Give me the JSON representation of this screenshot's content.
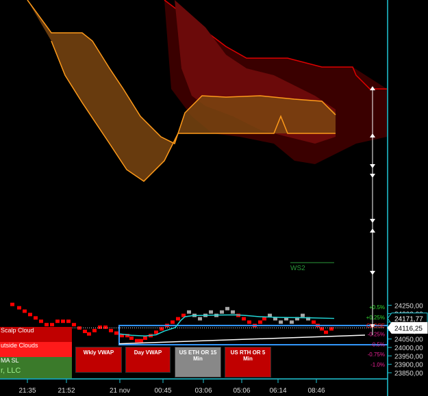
{
  "chart_data": {
    "type": "renko",
    "y_range": [
      23840,
      24290
    ],
    "y_ticks": [
      23850,
      23900,
      23950,
      24000,
      24050,
      24100,
      24150,
      24200,
      24250
    ],
    "y_tick_labels": [
      "23850,00",
      "23900,00",
      "23950,00",
      "24000,00",
      "24050,00",
      "24100,00",
      "24150,00",
      "24200,00",
      "24250,00"
    ],
    "x_labels": [
      "21:35",
      "21:52",
      "21 nov",
      "00:45",
      "03:06",
      "05:06",
      "06:14",
      "08:46"
    ],
    "last_price": "24171,77",
    "crosshair_price": "24116,25",
    "crosshair_value": 24116.25,
    "last_value": 24171.77,
    "pct_levels": [
      {
        "label": "+0.5%",
        "value": 24240,
        "color": "#33dd33"
      },
      {
        "label": "+0.25%",
        "value": 24179,
        "color": "#33dd33"
      },
      {
        "label": "CLOSE",
        "value": 24130,
        "color": "#ff2222"
      },
      {
        "label": "-0.25%",
        "value": 24079,
        "color": "#ee2299"
      },
      {
        "label": "-0.5%",
        "value": 24018,
        "color": "#ee2299"
      },
      {
        "label": "-0.75%",
        "value": 23960,
        "color": "#ee2299"
      },
      {
        "label": "-1.0%",
        "value": 23899,
        "color": "#ee2299"
      }
    ],
    "ws2_label": "WS2",
    "box_levels": [
      24130,
      24016
    ],
    "bricks": [
      {
        "x": 18,
        "c": "r",
        "lo": 24245,
        "hi": 24265
      },
      {
        "x": 28,
        "c": "r",
        "lo": 24225,
        "hi": 24245
      },
      {
        "x": 36,
        "c": "r",
        "lo": 24205,
        "hi": 24225
      },
      {
        "x": 44,
        "c": "r",
        "lo": 24185,
        "hi": 24205
      },
      {
        "x": 52,
        "c": "r",
        "lo": 24165,
        "hi": 24185
      },
      {
        "x": 60,
        "c": "r",
        "lo": 24145,
        "hi": 24165
      },
      {
        "x": 68,
        "c": "r",
        "lo": 24125,
        "hi": 24145
      },
      {
        "x": 76,
        "c": "r",
        "lo": 24125,
        "hi": 24145
      },
      {
        "x": 84,
        "c": "r",
        "lo": 24145,
        "hi": 24165
      },
      {
        "x": 92,
        "c": "r",
        "lo": 24145,
        "hi": 24165
      },
      {
        "x": 100,
        "c": "r",
        "lo": 24145,
        "hi": 24165
      },
      {
        "x": 108,
        "c": "r",
        "lo": 24125,
        "hi": 24145
      },
      {
        "x": 116,
        "c": "r",
        "lo": 24105,
        "hi": 24125
      },
      {
        "x": 124,
        "c": "r",
        "lo": 24085,
        "hi": 24105
      },
      {
        "x": 130,
        "c": "r",
        "lo": 24070,
        "hi": 24090
      },
      {
        "x": 138,
        "c": "r",
        "lo": 24090,
        "hi": 24110
      },
      {
        "x": 146,
        "c": "r",
        "lo": 24110,
        "hi": 24130
      },
      {
        "x": 154,
        "c": "r",
        "lo": 24110,
        "hi": 24130
      },
      {
        "x": 162,
        "c": "r",
        "lo": 24090,
        "hi": 24110
      },
      {
        "x": 170,
        "c": "r",
        "lo": 24075,
        "hi": 24095
      },
      {
        "x": 178,
        "c": "r",
        "lo": 24060,
        "hi": 24080
      },
      {
        "x": 186,
        "c": "r",
        "lo": 24060,
        "hi": 24080
      },
      {
        "x": 192,
        "c": "r",
        "lo": 24045,
        "hi": 24065
      },
      {
        "x": 200,
        "c": "r",
        "lo": 24030,
        "hi": 24050
      },
      {
        "x": 206,
        "c": "r",
        "lo": 24030,
        "hi": 24050
      },
      {
        "x": 212,
        "c": "r",
        "lo": 24045,
        "hi": 24065
      },
      {
        "x": 220,
        "c": "r",
        "lo": 24060,
        "hi": 24080
      },
      {
        "x": 228,
        "c": "r",
        "lo": 24080,
        "hi": 24100
      },
      {
        "x": 236,
        "c": "r",
        "lo": 24100,
        "hi": 24120
      },
      {
        "x": 244,
        "c": "r",
        "lo": 24120,
        "hi": 24140
      },
      {
        "x": 252,
        "c": "r",
        "lo": 24140,
        "hi": 24160
      },
      {
        "x": 260,
        "c": "r",
        "lo": 24160,
        "hi": 24180
      },
      {
        "x": 268,
        "c": "r",
        "lo": 24180,
        "hi": 24200
      },
      {
        "x": 276,
        "c": "g",
        "lo": 24200,
        "hi": 24220
      },
      {
        "x": 284,
        "c": "g",
        "lo": 24180,
        "hi": 24200
      },
      {
        "x": 292,
        "c": "g",
        "lo": 24160,
        "hi": 24180
      },
      {
        "x": 300,
        "c": "g",
        "lo": 24180,
        "hi": 24200
      },
      {
        "x": 308,
        "c": "g",
        "lo": 24200,
        "hi": 24220
      },
      {
        "x": 316,
        "c": "g",
        "lo": 24180,
        "hi": 24200
      },
      {
        "x": 324,
        "c": "g",
        "lo": 24200,
        "hi": 24220
      },
      {
        "x": 332,
        "c": "g",
        "lo": 24220,
        "hi": 24240
      },
      {
        "x": 340,
        "c": "g",
        "lo": 24200,
        "hi": 24220
      },
      {
        "x": 348,
        "c": "r",
        "lo": 24180,
        "hi": 24200
      },
      {
        "x": 356,
        "c": "r",
        "lo": 24160,
        "hi": 24180
      },
      {
        "x": 364,
        "c": "r",
        "lo": 24140,
        "hi": 24160
      },
      {
        "x": 372,
        "c": "r",
        "lo": 24120,
        "hi": 24140
      },
      {
        "x": 380,
        "c": "r",
        "lo": 24140,
        "hi": 24160
      },
      {
        "x": 386,
        "c": "r",
        "lo": 24160,
        "hi": 24180
      },
      {
        "x": 394,
        "c": "g",
        "lo": 24180,
        "hi": 24200
      },
      {
        "x": 402,
        "c": "g",
        "lo": 24160,
        "hi": 24180
      },
      {
        "x": 410,
        "c": "g",
        "lo": 24140,
        "hi": 24160
      },
      {
        "x": 418,
        "c": "g",
        "lo": 24160,
        "hi": 24180
      },
      {
        "x": 426,
        "c": "g",
        "lo": 24140,
        "hi": 24160
      },
      {
        "x": 434,
        "c": "g",
        "lo": 24160,
        "hi": 24180
      },
      {
        "x": 442,
        "c": "g",
        "lo": 24180,
        "hi": 24200
      },
      {
        "x": 450,
        "c": "g",
        "lo": 24160,
        "hi": 24180
      },
      {
        "x": 458,
        "c": "r",
        "lo": 24140,
        "hi": 24160
      },
      {
        "x": 464,
        "c": "r",
        "lo": 24120,
        "hi": 24140
      },
      {
        "x": 470,
        "c": "r",
        "lo": 24100,
        "hi": 24120
      },
      {
        "x": 476,
        "c": "r",
        "lo": 24080,
        "hi": 24100
      },
      {
        "x": 484,
        "c": "r",
        "lo": 24100,
        "hi": 24120
      }
    ]
  },
  "legend": {
    "scalp_cloud": "Scalp Cloud",
    "outside_clouds": "utside Clouds",
    "ma_sl": "MA SL",
    "llc": "r, LLC"
  },
  "buttons": {
    "wkly_vwap": "Wkly VWAP",
    "day_vwap": "Day VWAP",
    "us_eth": "US ETH OR 15 Min",
    "us_rth": "US RTH OR 5 Min"
  },
  "colors": {
    "bear_brick": "#ff0000",
    "bull_brick": "#a6a6a6",
    "axis": "#20c8d8",
    "box": "#3399ff",
    "vwap_line": "#22d8d8",
    "cloud_orange": "#ff9b1a",
    "cloud_red": "#e00000"
  }
}
